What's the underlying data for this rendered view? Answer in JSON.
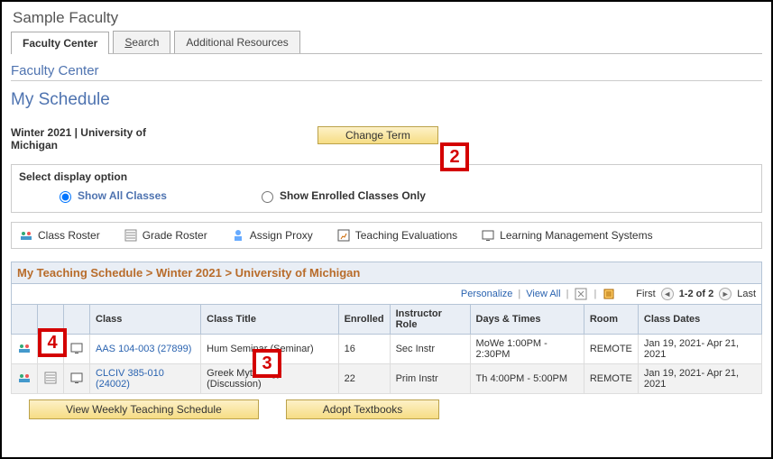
{
  "page_title": "Sample Faculty",
  "tabs": [
    {
      "label": "Faculty Center",
      "active": true
    },
    {
      "label": "Search",
      "active": false
    },
    {
      "label": "Additional Resources",
      "active": false
    }
  ],
  "section_heading": "Faculty Center",
  "schedule_heading": "My Schedule",
  "term_text": "Winter 2021 | University of Michigan",
  "change_term_label": "Change Term",
  "display_option": {
    "label": "Select display option",
    "options": [
      {
        "label": "Show All Classes",
        "selected": true
      },
      {
        "label": "Show Enrolled Classes Only",
        "selected": false
      }
    ]
  },
  "tool_links": [
    "Class Roster",
    "Grade Roster",
    "Assign Proxy",
    "Teaching Evaluations",
    "Learning Management Systems"
  ],
  "teaching_schedule_header": "My Teaching Schedule > Winter 2021 > University of Michigan",
  "grid_toolbar": {
    "personalize": "Personalize",
    "view_all": "View All",
    "first": "First",
    "range": "1-2 of 2",
    "last": "Last"
  },
  "columns": [
    "",
    "",
    "",
    "Class",
    "Class Title",
    "Enrolled",
    "Instructor Role",
    "Days & Times",
    "Room",
    "Class Dates"
  ],
  "rows": [
    {
      "class": "AAS 104-003 (27899)",
      "title": "Hum Seminar (Seminar)",
      "enrolled": "16",
      "role": "Sec Instr",
      "days": "MoWe 1:00PM - 2:30PM",
      "room": "REMOTE",
      "dates": "Jan 19, 2021- Apr 21, 2021"
    },
    {
      "class": "CLCIV 385-010 (24002)",
      "title": "Greek Mythology (Discussion)",
      "enrolled": "22",
      "role": "Prim Instr",
      "days": "Th 4:00PM - 5:00PM",
      "room": "REMOTE",
      "dates": "Jan 19, 2021- Apr 21, 2021"
    }
  ],
  "bottom_buttons": {
    "weekly": "View Weekly Teaching Schedule",
    "textbooks": "Adopt Textbooks"
  },
  "callouts": {
    "c2": "2",
    "c3": "3",
    "c4": "4"
  },
  "colors": {
    "accent_blue": "#4e73b0",
    "callout_red": "#d40000",
    "header_orange": "#b86c2b"
  }
}
